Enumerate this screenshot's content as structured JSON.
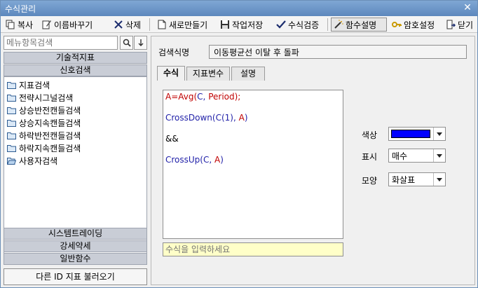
{
  "window": {
    "title": "수식관리",
    "close_glyph": "✕"
  },
  "toolbar": {
    "copy": "복사",
    "rename": "이름바꾸기",
    "delete": "삭제",
    "new": "새로만들기",
    "save": "작업저장",
    "verify": "수식검증",
    "func_help": "함수설명",
    "password": "암호설정",
    "close": "닫기"
  },
  "sidebar": {
    "search_placeholder": "메뉴항목검색",
    "categories_top": [
      "기술적지표",
      "신호검색"
    ],
    "tree_items": [
      "지표검색",
      "전략시그널검색",
      "상승반전캔들검색",
      "상승지속캔들검색",
      "하락반전캔들검색",
      "하락지속캔들검색",
      "사용자검색"
    ],
    "categories_bottom": [
      "시스템트레이딩",
      "강세약세",
      "일반함수"
    ],
    "load_button": "다른 ID 지표 불러오기"
  },
  "main": {
    "name_label": "검색식명",
    "name_value": "이동평균선 이탈 후 돌파",
    "tabs": [
      "수식",
      "지표변수",
      "설명"
    ],
    "formula_lines": [
      [
        {
          "t": "A=Avg(",
          "c": "red"
        },
        {
          "t": "C, ",
          "c": "blue"
        },
        {
          "t": "Period",
          "c": "red"
        },
        {
          "t": ");",
          "c": "red"
        }
      ],
      [],
      [
        {
          "t": "CrossDown(C(1), ",
          "c": "blue"
        },
        {
          "t": "A",
          "c": "red"
        },
        {
          "t": ")",
          "c": "blue"
        }
      ],
      [],
      [
        {
          "t": "&&",
          "c": "black"
        }
      ],
      [],
      [
        {
          "t": "CrossUp(C, ",
          "c": "blue"
        },
        {
          "t": "A",
          "c": "red"
        },
        {
          "t": ")",
          "c": "blue"
        }
      ]
    ],
    "formula_input_placeholder": "수식을 입력하세요",
    "color_label": "색상",
    "color_value": "#0000ff",
    "display_label": "표시",
    "display_value": "매수",
    "shape_label": "모양",
    "shape_value": "화살표"
  }
}
